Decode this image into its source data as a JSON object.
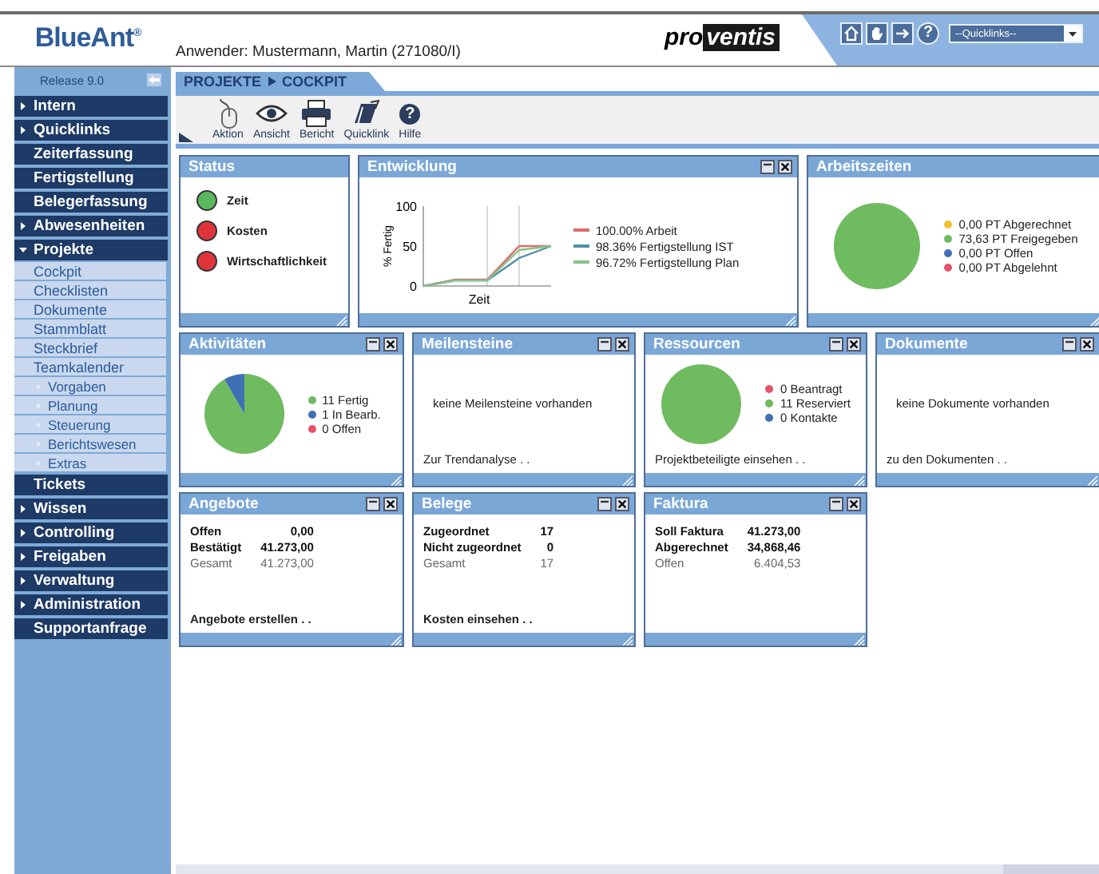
{
  "header": {
    "logo": "BlueAnt$^{®}$",
    "user": "Anwender: Mustermann, Martin (271080/I)",
    "brand": [
      "pro",
      "ventis"
    ],
    "buttons": [
      {
        "kind": "home"
      },
      {
        "kind": "hand"
      },
      {
        "kind": "exit"
      },
      {
        "kind": "help",
        "glyph": "?"
      }
    ],
    "quicklinks": {
      "value": "--Quicklinks--"
    }
  },
  "sidebar": {
    "release": "Release 9.0",
    "items": [
      {
        "label": "Intern",
        "kind": "group",
        "expanded": false
      },
      {
        "label": "Quicklinks",
        "kind": "group",
        "expanded": false
      },
      {
        "label": "Zeiterfassung",
        "kind": "link"
      },
      {
        "label": "Fertigstellung",
        "kind": "link"
      },
      {
        "label": "Belegerfassung",
        "kind": "link"
      },
      {
        "label": "Abwesenheiten",
        "kind": "group",
        "expanded": false
      },
      {
        "label": "Projekte",
        "kind": "group",
        "expanded": true,
        "children": [
          {
            "label": "Cockpit",
            "kind": "link"
          },
          {
            "label": "Checklisten",
            "kind": "link"
          },
          {
            "label": "Dokumente",
            "kind": "link"
          },
          {
            "label": "Stammblatt",
            "kind": "link"
          },
          {
            "label": "Steckbrief",
            "kind": "link"
          },
          {
            "label": "Teamkalender",
            "kind": "link"
          },
          {
            "label": "Vorgaben",
            "kind": "bullet"
          },
          {
            "label": "Planung",
            "kind": "bullet"
          },
          {
            "label": "Steuerung",
            "kind": "bullet"
          },
          {
            "label": "Berichtswesen",
            "kind": "bullet"
          },
          {
            "label": "Extras",
            "kind": "bullet"
          }
        ]
      },
      {
        "label": "Tickets",
        "kind": "link"
      },
      {
        "label": "Wissen",
        "kind": "group",
        "expanded": false
      },
      {
        "label": "Controlling",
        "kind": "group",
        "expanded": false
      },
      {
        "label": "Freigaben",
        "kind": "group",
        "expanded": false
      },
      {
        "label": "Verwaltung",
        "kind": "group",
        "expanded": false
      },
      {
        "label": "Administration",
        "kind": "group",
        "expanded": false
      },
      {
        "label": "Supportanfrage",
        "kind": "link"
      }
    ]
  },
  "breadcrumb": [
    "PROJEKTE",
    "COCKPIT"
  ],
  "toolbar": [
    {
      "label": "Aktion",
      "kind": "action"
    },
    {
      "label": "Ansicht",
      "kind": "view"
    },
    {
      "label": "Bericht",
      "kind": "report"
    },
    {
      "label": "Quicklink",
      "kind": "quicklink"
    },
    {
      "label": "Hilfe",
      "kind": "help",
      "glyph": "?"
    }
  ],
  "widget_rows": [
    {
      "widgets": [
        {
          "title": "Status",
          "closable": false,
          "kind": "status",
          "items": [
            {
              "label": "Zeit",
              "color": "#5cb85c"
            },
            {
              "label": "Kosten",
              "color": "#e0343c"
            },
            {
              "label": "Wirtschaftlichkeit",
              "color": "#e0343c"
            }
          ]
        },
        {
          "title": "Entwicklung",
          "closable": true,
          "kind": "chart",
          "chart_data": {
            "type": "line",
            "xlabel": "Zeit",
            "ylabel": "% Fertig",
            "legend": "right",
            "ylim": [
              0,
              100
            ],
            "yticks": [
              0,
              50,
              100
            ],
            "series": [
              {
                "name": "100.00% Arbeit",
                "color": "#e06a6a",
                "values": [
                  0,
                  8,
                  8,
                  50,
                  50
                ]
              },
              {
                "name": "98.36% Fertigstellung IST",
                "color": "#4f8fa8",
                "values": [
                  0,
                  7,
                  7,
                  35,
                  50
                ]
              },
              {
                "name": "96.72% Fertigstellung Plan",
                "color": "#86c48a",
                "values": [
                  0,
                  7,
                  7,
                  45,
                  50
                ]
              }
            ]
          }
        },
        {
          "title": "Arbeitszeiten",
          "closable": false,
          "kind": "chart",
          "chart_data": {
            "type": "pie",
            "legend": "right",
            "categories": [
              "0,00 PT Abgerechnet",
              "73,63 PT Freigegeben",
              "0,00 PT Offen",
              "0,00 PT Abgelehnt"
            ],
            "values": [
              0,
              73.63,
              0,
              0
            ],
            "colors": [
              "#f2c035",
              "#6fbb5f",
              "#3f6fb5",
              "#e8506a"
            ]
          }
        }
      ]
    },
    {
      "widgets": [
        {
          "title": "Aktivitäten",
          "closable": true,
          "kind": "chart",
          "chart_data": {
            "type": "pie",
            "legend": "right",
            "categories": [
              "11 Fertig",
              "1 In Bearb.",
              "0 Offen"
            ],
            "values": [
              11,
              1,
              0
            ],
            "colors": [
              "#6fbb5f",
              "#3f6fb5",
              "#e8506a"
            ]
          }
        },
        {
          "title": "Meilensteine",
          "closable": true,
          "kind": "message",
          "message": "keine Meilensteine vorhanden",
          "link": "Zur Trendanalyse . ."
        },
        {
          "title": "Ressourcen",
          "closable": true,
          "kind": "chart",
          "chart_data": {
            "type": "pie",
            "legend": "right",
            "categories": [
              "0 Beantragt",
              "11 Reserviert",
              "0 Kontakte"
            ],
            "values": [
              0,
              11,
              0
            ],
            "colors": [
              "#e8506a",
              "#6fbb5f",
              "#3f6fb5"
            ]
          },
          "link": "Projektbeteiligte einsehen . ."
        },
        {
          "title": "Dokumente",
          "closable": true,
          "kind": "message",
          "message": "keine Dokumente vorhanden",
          "link": "zu den Dokumenten . ."
        }
      ]
    },
    {
      "widgets": [
        {
          "title": "Angebote",
          "closable": true,
          "kind": "figures",
          "rows": [
            {
              "label": "Offen",
              "value": "0,00",
              "kind": "strong"
            },
            {
              "label": "Bestätigt",
              "value": "41.273,00",
              "kind": "strong"
            },
            {
              "label": "Gesamt",
              "value": "41.273,00",
              "kind": "muted"
            }
          ],
          "link": "Angebote erstellen . ."
        },
        {
          "title": "Belege",
          "closable": true,
          "kind": "figures",
          "rows": [
            {
              "label": "Zugeordnet",
              "value": "17",
              "kind": "strong"
            },
            {
              "label": "Nicht zugeordnet",
              "value": "0",
              "kind": "strong"
            },
            {
              "label": "Gesamt",
              "value": "17",
              "kind": "muted"
            }
          ],
          "link": "Kosten einsehen . ."
        },
        {
          "title": "Faktura",
          "closable": true,
          "kind": "figures",
          "rows": [
            {
              "label": "Soll Faktura",
              "value": "41.273,00",
              "kind": "strong"
            },
            {
              "label": "Abgerechnet",
              "value": "34,868,46",
              "kind": "strong"
            },
            {
              "label": "Offen",
              "value": "6.404,53",
              "kind": "muted"
            }
          ]
        }
      ]
    }
  ]
}
